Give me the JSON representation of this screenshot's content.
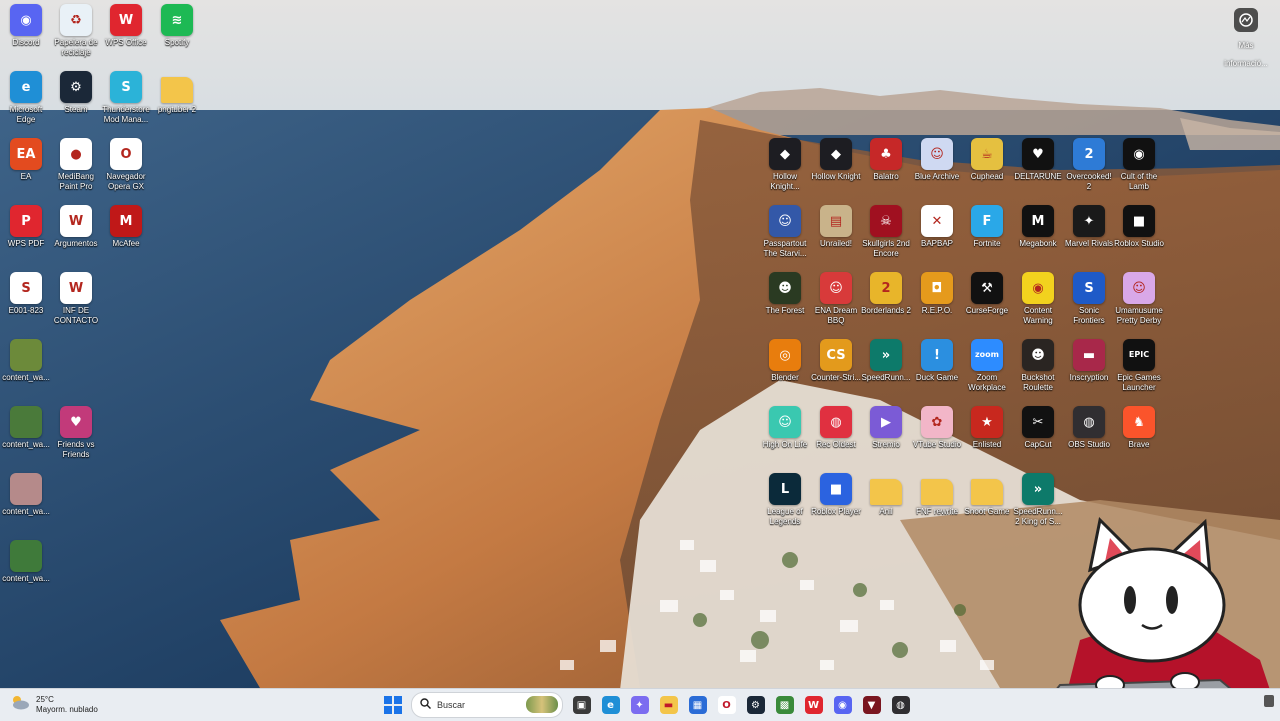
{
  "desktop_icons_left": [
    {
      "label": "Discord",
      "color": "#5865F2",
      "glyph": "◉",
      "icon": "discord-icon"
    },
    {
      "label": "Papelera de reciclaje",
      "color": "#e9f1f7",
      "glyph": "♻",
      "icon": "recycle-bin-icon"
    },
    {
      "label": "WPS Office",
      "color": "#e0262f",
      "glyph": "W",
      "icon": "wps-office-icon"
    },
    {
      "label": "Spotify",
      "color": "#1DB954",
      "glyph": "≋",
      "icon": "spotify-icon"
    },
    {
      "label": "Microsoft Edge",
      "color": "#1f8fd6",
      "glyph": "e",
      "icon": "edge-icon"
    },
    {
      "label": "Steam",
      "color": "#1b2838",
      "glyph": "⚙",
      "icon": "steam-icon"
    },
    {
      "label": "Thunderstore Mod Mana...",
      "color": "#2bb3d8",
      "glyph": "S",
      "icon": "thunderstore-icon"
    },
    {
      "label": "pngtuber 2",
      "color": "#f3c54a",
      "glyph": "",
      "icon": "folder-icon"
    },
    {
      "label": "EA",
      "color": "#e34b1f",
      "glyph": "EA",
      "icon": "ea-icon"
    },
    {
      "label": "MediBang Paint Pro",
      "color": "#ffffff",
      "glyph": "●",
      "icon": "medibang-icon"
    },
    {
      "label": "Navegador Opera GX",
      "color": "#ffffff",
      "glyph": "O",
      "icon": "opera-gx-icon"
    },
    {
      "label": "WPS PDF",
      "color": "#e0262f",
      "glyph": "P",
      "icon": "wps-pdf-icon"
    },
    {
      "label": "Argumentos",
      "color": "#ffffff",
      "glyph": "W",
      "icon": "word-doc-icon"
    },
    {
      "label": "McAfee",
      "color": "#c01818",
      "glyph": "M",
      "icon": "mcafee-icon"
    },
    {
      "label": "E001-823",
      "color": "#ffffff",
      "glyph": "S",
      "icon": "sheet-doc-icon"
    },
    {
      "label": "INF DE CONTACTO",
      "color": "#ffffff",
      "glyph": "W",
      "icon": "word-doc-icon"
    },
    {
      "label": "content_wa...",
      "color": "#6c8a3a",
      "glyph": "",
      "icon": "image-file-icon"
    },
    {
      "label": "content_wa...",
      "color": "#4a7a3a",
      "glyph": "",
      "icon": "image-file-icon"
    },
    {
      "label": "Friends vs Friends",
      "color": "#c23a7a",
      "glyph": "♥",
      "icon": "friends-vs-friends-icon"
    },
    {
      "label": "content_wa...",
      "color": "#b58a8a",
      "glyph": "",
      "icon": "image-file-icon"
    },
    {
      "label": "content_wa...",
      "color": "#3f7a3a",
      "glyph": "",
      "icon": "image-file-icon"
    }
  ],
  "desktop_icons_grid": [
    {
      "label": "Hollow Knight...",
      "color": "#1d1d22",
      "glyph": "◆",
      "icon": "hollow-knight-icon"
    },
    {
      "label": "Hollow Knight",
      "color": "#1d1d22",
      "glyph": "◆",
      "icon": "hollow-knight-icon"
    },
    {
      "label": "Balatro",
      "color": "#c62828",
      "glyph": "♣",
      "icon": "balatro-icon"
    },
    {
      "label": "Blue Archive",
      "color": "#cfd9f2",
      "glyph": "☺",
      "icon": "blue-archive-icon"
    },
    {
      "label": "Cuphead",
      "color": "#e5c040",
      "glyph": "☕",
      "icon": "cuphead-icon"
    },
    {
      "label": "DELTARUNE",
      "color": "#111111",
      "glyph": "♥",
      "icon": "deltarune-icon"
    },
    {
      "label": "Overcooked! 2",
      "color": "#2e7bd6",
      "glyph": "2",
      "icon": "overcooked-icon"
    },
    {
      "label": "Cult of the Lamb",
      "color": "#111111",
      "glyph": "◉",
      "icon": "cult-of-the-lamb-icon"
    },
    {
      "label": "Passpartout The Starvi...",
      "color": "#3358a8",
      "glyph": "☺",
      "icon": "passpartout-icon"
    },
    {
      "label": "Unrailed!",
      "color": "#c9b38a",
      "glyph": "▤",
      "icon": "unrailed-icon"
    },
    {
      "label": "Skullgirls 2nd Encore",
      "color": "#a01020",
      "glyph": "☠",
      "icon": "skullgirls-icon"
    },
    {
      "label": "BAPBAP",
      "color": "#ffffff",
      "glyph": "✕",
      "icon": "bapbap-icon"
    },
    {
      "label": "Fortnite",
      "color": "#2aa8e8",
      "glyph": "F",
      "icon": "fortnite-icon"
    },
    {
      "label": "Megabonk",
      "color": "#111111",
      "glyph": "M",
      "icon": "megabonk-icon"
    },
    {
      "label": "Marvel Rivals",
      "color": "#1a1a1a",
      "glyph": "✦",
      "icon": "marvel-rivals-icon"
    },
    {
      "label": "Roblox Studio",
      "color": "#111111",
      "glyph": "■",
      "icon": "roblox-studio-icon"
    },
    {
      "label": "The Forest",
      "color": "#2a3a22",
      "glyph": "☻",
      "icon": "the-forest-icon"
    },
    {
      "label": "ENA Dream BBQ",
      "color": "#d83a3a",
      "glyph": "☺",
      "icon": "ena-icon"
    },
    {
      "label": "Borderlands 2",
      "color": "#e8b52a",
      "glyph": "2",
      "icon": "borderlands-icon"
    },
    {
      "label": "R.E.P.O.",
      "color": "#e59a1c",
      "glyph": "◘",
      "icon": "repo-icon"
    },
    {
      "label": "CurseForge",
      "color": "#111111",
      "glyph": "⚒",
      "icon": "curseforge-icon"
    },
    {
      "label": "Content Warning",
      "color": "#f2d21e",
      "glyph": "◉",
      "icon": "content-warning-icon"
    },
    {
      "label": "Sonic Frontiers",
      "color": "#1e5ac8",
      "glyph": "S",
      "icon": "sonic-icon"
    },
    {
      "label": "Umamusume Pretty Derby",
      "color": "#d9a8e8",
      "glyph": "☺",
      "icon": "umamusume-icon"
    },
    {
      "label": "Blender",
      "color": "#e87d0d",
      "glyph": "◎",
      "icon": "blender-icon"
    },
    {
      "label": "Counter-Stri...",
      "color": "#e39a1c",
      "glyph": "CS",
      "icon": "counter-strike-icon"
    },
    {
      "label": "SpeedRunn...",
      "color": "#0d7a6a",
      "glyph": "»",
      "icon": "speedrunners-icon"
    },
    {
      "label": "Duck Game",
      "color": "#2b8fe0",
      "glyph": "!",
      "icon": "duck-game-icon"
    },
    {
      "label": "Zoom Workplace",
      "color": "#2d8cff",
      "glyph": "zoom",
      "icon": "zoom-icon"
    },
    {
      "label": "Buckshot Roulette",
      "color": "#2a2522",
      "glyph": "☻",
      "icon": "buckshot-roulette-icon"
    },
    {
      "label": "Inscryption",
      "color": "#a8284a",
      "glyph": "▬",
      "icon": "inscryption-icon"
    },
    {
      "label": "Epic Games Launcher",
      "color": "#111111",
      "glyph": "EPIC",
      "icon": "epic-games-icon"
    },
    {
      "label": "High On Life",
      "color": "#3ac8b0",
      "glyph": "☺",
      "icon": "high-on-life-icon"
    },
    {
      "label": "Rec Oldest",
      "color": "#e03040",
      "glyph": "◍",
      "icon": "rec-room-icon"
    },
    {
      "label": "Stremio",
      "color": "#7b5bd6",
      "glyph": "▶",
      "icon": "stremio-icon"
    },
    {
      "label": "VTube Studio",
      "color": "#f2b6c8",
      "glyph": "✿",
      "icon": "vtube-studio-icon"
    },
    {
      "label": "Enlisted",
      "color": "#c8281e",
      "glyph": "★",
      "icon": "enlisted-icon"
    },
    {
      "label": "CapCut",
      "color": "#111111",
      "glyph": "✂",
      "icon": "capcut-icon"
    },
    {
      "label": "OBS Studio",
      "color": "#302e31",
      "glyph": "◍",
      "icon": "obs-studio-icon"
    },
    {
      "label": "Brave",
      "color": "#fb542b",
      "glyph": "♞",
      "icon": "brave-icon"
    },
    {
      "label": "League of Legends",
      "color": "#0b2a3a",
      "glyph": "L",
      "icon": "league-of-legends-icon"
    },
    {
      "label": "Roblox Player",
      "color": "#2b63e0",
      "glyph": "■",
      "icon": "roblox-player-icon"
    },
    {
      "label": "Anil",
      "color": "#f3c54a",
      "glyph": "",
      "icon": "folder-icon"
    },
    {
      "label": "FNF rewrite",
      "color": "#f3c54a",
      "glyph": "",
      "icon": "folder-icon"
    },
    {
      "label": "Snoot Game",
      "color": "#f3c54a",
      "glyph": "",
      "icon": "folder-icon"
    },
    {
      "label": "SpeedRunn... 2 King of S...",
      "color": "#0d7a6a",
      "glyph": "»",
      "icon": "speedrunners-2-icon"
    }
  ],
  "more_info": {
    "label": "Más informació..."
  },
  "weather": {
    "temp": "25°C",
    "desc": "Mayorm. nublado"
  },
  "search": {
    "placeholder": "Buscar"
  },
  "taskbar_apps": [
    {
      "icon": "task-view-icon",
      "color": "#3a3a3a",
      "glyph": "▣"
    },
    {
      "icon": "edge-icon",
      "color": "#1f8fd6",
      "glyph": "e"
    },
    {
      "icon": "copilot-icon",
      "color": "#7b6cf0",
      "glyph": "✦"
    },
    {
      "icon": "file-explorer-icon",
      "color": "#f3c54a",
      "glyph": "▬"
    },
    {
      "icon": "microsoft-store-icon",
      "color": "#2b6cd6",
      "glyph": "▦"
    },
    {
      "icon": "opera-gx-icon",
      "color": "#ffffff",
      "glyph": "O"
    },
    {
      "icon": "steam-icon",
      "color": "#1b2838",
      "glyph": "⚙"
    },
    {
      "icon": "minecraft-icon",
      "color": "#3a8a3a",
      "glyph": "▩"
    },
    {
      "icon": "wps-office-icon",
      "color": "#e0262f",
      "glyph": "W"
    },
    {
      "icon": "discord-icon",
      "color": "#5865F2",
      "glyph": "◉"
    },
    {
      "icon": "vtuber-app-icon",
      "color": "#7a1620",
      "glyph": "▼"
    },
    {
      "icon": "obs-studio-icon",
      "color": "#302e31",
      "glyph": "◍"
    }
  ],
  "colors": {
    "taskbar": "#e9edf2",
    "sea": "#2a4c73",
    "sky": "#dfe3e6"
  }
}
